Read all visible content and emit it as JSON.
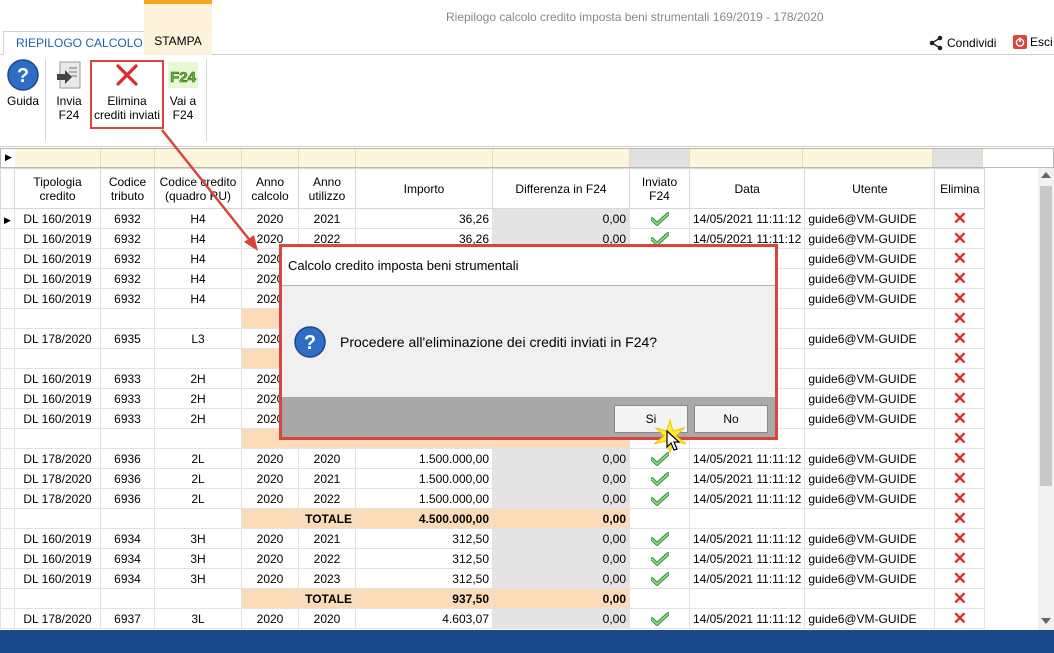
{
  "window": {
    "title": "Riepilogo calcolo credito imposta beni strumentali 169/2019 - 178/2020"
  },
  "tabs": [
    {
      "label": "RIEPILOGO CALCOLO"
    },
    {
      "label": "STAMPA"
    }
  ],
  "topright": {
    "share": "Condividi",
    "exit": "Esci"
  },
  "ribbon": {
    "guida": "Guida",
    "invia_1": "Invia",
    "invia_2": "F24",
    "elimina_1": "Elimina",
    "elimina_2": "crediti inviati",
    "vai_1": "Vai a",
    "vai_2": "F24",
    "f24_logo": "F24"
  },
  "columns": [
    "Tipologia credito",
    "Codice tributo",
    "Codice credito (quadro RU)",
    "Anno calcolo",
    "Anno utilizzo",
    "Importo",
    "Differenza in F24",
    "Inviato F24",
    "Data",
    "Utente",
    "Elimina"
  ],
  "rows": [
    {
      "t": "d",
      "tip": "DL 160/2019",
      "cod": "6932",
      "cc": "H4",
      "ac": "2020",
      "au": "2021",
      "imp": "36,26",
      "diff": "0,00",
      "data": "14/05/2021 11:11:12",
      "ut": "guide6@VM-GUIDE"
    },
    {
      "t": "d",
      "tip": "DL 160/2019",
      "cod": "6932",
      "cc": "H4",
      "ac": "2020",
      "au": "2022",
      "imp": "36,26",
      "diff": "0,00",
      "data": "14/05/2021 11:11:12",
      "ut": "guide6@VM-GUIDE"
    },
    {
      "t": "d",
      "tip": "DL 160/2019",
      "cod": "6932",
      "cc": "H4",
      "ac": "2020",
      "au": "",
      "imp": "",
      "diff": "",
      "data": "",
      "ut": "guide6@VM-GUIDE"
    },
    {
      "t": "d",
      "tip": "DL 160/2019",
      "cod": "6932",
      "cc": "H4",
      "ac": "2020",
      "au": "",
      "imp": "",
      "diff": "",
      "data": "",
      "ut": "guide6@VM-GUIDE"
    },
    {
      "t": "d",
      "tip": "DL 160/2019",
      "cod": "6932",
      "cc": "H4",
      "ac": "2020",
      "au": "",
      "imp": "",
      "diff": "",
      "data": "",
      "ut": "guide6@VM-GUIDE"
    },
    {
      "t": "t",
      "label": "",
      "imp": "",
      "diff": ""
    },
    {
      "t": "d",
      "tip": "DL 178/2020",
      "cod": "6935",
      "cc": "L3",
      "ac": "2020",
      "au": "",
      "imp": "",
      "diff": "",
      "data": "",
      "ut": "guide6@VM-GUIDE"
    },
    {
      "t": "t",
      "label": "",
      "imp": "",
      "diff": ""
    },
    {
      "t": "d",
      "tip": "DL 160/2019",
      "cod": "6933",
      "cc": "2H",
      "ac": "2020",
      "au": "",
      "imp": "",
      "diff": "",
      "data": "",
      "ut": "guide6@VM-GUIDE"
    },
    {
      "t": "d",
      "tip": "DL 160/2019",
      "cod": "6933",
      "cc": "2H",
      "ac": "2020",
      "au": "",
      "imp": "",
      "diff": "",
      "data": "",
      "ut": "guide6@VM-GUIDE"
    },
    {
      "t": "d",
      "tip": "DL 160/2019",
      "cod": "6933",
      "cc": "2H",
      "ac": "2020",
      "au": "",
      "imp": "",
      "diff": "",
      "data": "",
      "ut": "guide6@VM-GUIDE"
    },
    {
      "t": "t",
      "label": "",
      "imp": "",
      "diff": ""
    },
    {
      "t": "d",
      "tip": "DL 178/2020",
      "cod": "6936",
      "cc": "2L",
      "ac": "2020",
      "au": "2020",
      "imp": "1.500.000,00",
      "diff": "0,00",
      "data": "14/05/2021 11:11:12",
      "ut": "guide6@VM-GUIDE"
    },
    {
      "t": "d",
      "tip": "DL 178/2020",
      "cod": "6936",
      "cc": "2L",
      "ac": "2020",
      "au": "2021",
      "imp": "1.500.000,00",
      "diff": "0,00",
      "data": "14/05/2021 11:11:12",
      "ut": "guide6@VM-GUIDE"
    },
    {
      "t": "d",
      "tip": "DL 178/2020",
      "cod": "6936",
      "cc": "2L",
      "ac": "2020",
      "au": "2022",
      "imp": "1.500.000,00",
      "diff": "0,00",
      "data": "14/05/2021 11:11:12",
      "ut": "guide6@VM-GUIDE"
    },
    {
      "t": "t",
      "label": "TOTALE",
      "imp": "4.500.000,00",
      "diff": "0,00"
    },
    {
      "t": "d",
      "tip": "DL 160/2019",
      "cod": "6934",
      "cc": "3H",
      "ac": "2020",
      "au": "2021",
      "imp": "312,50",
      "diff": "0,00",
      "data": "14/05/2021 11:11:12",
      "ut": "guide6@VM-GUIDE"
    },
    {
      "t": "d",
      "tip": "DL 160/2019",
      "cod": "6934",
      "cc": "3H",
      "ac": "2020",
      "au": "2022",
      "imp": "312,50",
      "diff": "0,00",
      "data": "14/05/2021 11:11:12",
      "ut": "guide6@VM-GUIDE"
    },
    {
      "t": "d",
      "tip": "DL 160/2019",
      "cod": "6934",
      "cc": "3H",
      "ac": "2020",
      "au": "2023",
      "imp": "312,50",
      "diff": "0,00",
      "data": "14/05/2021 11:11:12",
      "ut": "guide6@VM-GUIDE"
    },
    {
      "t": "t",
      "label": "TOTALE",
      "imp": "937,50",
      "diff": "0,00"
    },
    {
      "t": "d",
      "tip": "DL 178/2020",
      "cod": "6937",
      "cc": "3L",
      "ac": "2020",
      "au": "2020",
      "imp": "4.603,07",
      "diff": "0,00",
      "data": "14/05/2021 11:11:12",
      "ut": "guide6@VM-GUIDE"
    }
  ],
  "dialog": {
    "title": "Calcolo credito imposta beni strumentali",
    "message": "Procedere all'eliminazione dei crediti inviati in F24?",
    "yes": "Si",
    "no": "No"
  },
  "colors": {
    "accent_red": "#d9453c",
    "total_row": "#fcdcb8",
    "filter_row": "#fdf6dc",
    "bottom_bar": "#1a4a8c",
    "check_green": "#3aa53a",
    "delete_red": "#e0262f"
  }
}
